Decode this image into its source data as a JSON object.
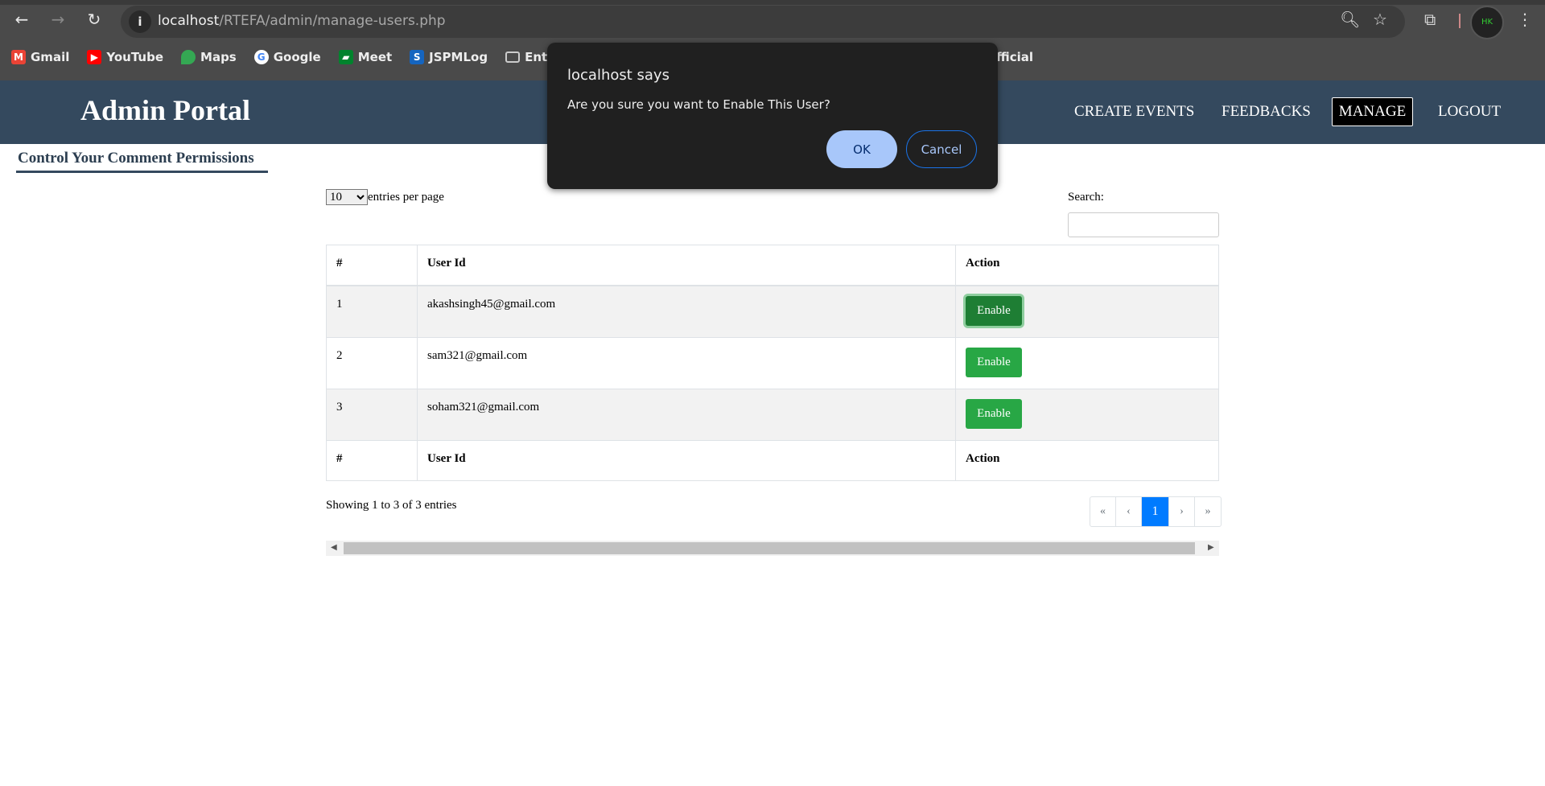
{
  "browser": {
    "url_host": "localhost",
    "url_path": "/RTEFA/admin/manage-users.php",
    "avatar_text": "HK",
    "bookmarks": [
      {
        "label": "Gmail",
        "icon": "gmail-icon",
        "color": "#ea4335"
      },
      {
        "label": "YouTube",
        "icon": "youtube-icon",
        "color": "#ff0000"
      },
      {
        "label": "Maps",
        "icon": "maps-icon",
        "color": "#34a853"
      },
      {
        "label": "Google",
        "icon": "google-icon",
        "color": "#4285f4"
      },
      {
        "label": "Meet",
        "icon": "meet-icon",
        "color": "#00832d"
      },
      {
        "label": "JSPMLog",
        "icon": "jspm-icon",
        "color": "#1565c0"
      },
      {
        "label": "Entertain",
        "icon": "folder-icon",
        "color": "#4a4a4a"
      }
    ],
    "bookmark_partial": "fficial"
  },
  "header": {
    "title": "Admin Portal",
    "nav": [
      "CREATE EVENTS",
      "FEEDBACKS",
      "MANAGE",
      "LOGOUT"
    ],
    "active": "MANAGE",
    "color": "#34495e"
  },
  "page": {
    "subtitle": "Control Your Comment Permissions",
    "entries_value": "10",
    "entries_label": "entries per page",
    "search_label": "Search:",
    "search_value": "",
    "columns": [
      "#",
      "User Id",
      "Action"
    ],
    "rows": [
      {
        "n": "1",
        "user": "akashsingh45@gmail.com",
        "action": "Enable"
      },
      {
        "n": "2",
        "user": "sam321@gmail.com",
        "action": "Enable"
      },
      {
        "n": "3",
        "user": "soham321@gmail.com",
        "action": "Enable"
      }
    ],
    "showing": "Showing 1 to 3 of 3 entries",
    "pager": [
      "«",
      "‹",
      "1",
      "›",
      "»"
    ],
    "current_page": "1"
  },
  "dialog": {
    "title": "localhost says",
    "message": "Are you sure you want to Enable This User?",
    "ok": "OK",
    "cancel": "Cancel"
  }
}
